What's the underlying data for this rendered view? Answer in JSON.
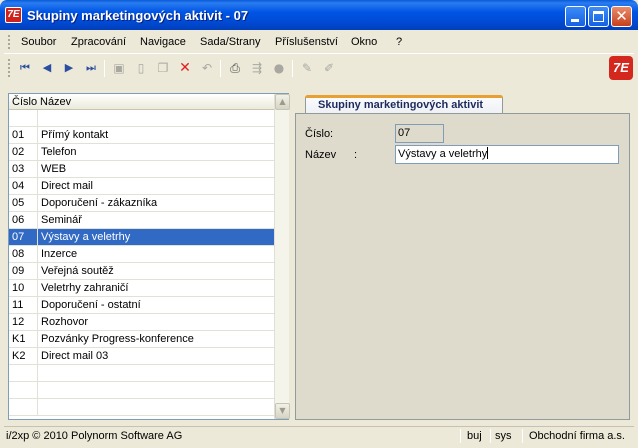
{
  "window": {
    "title": "Skupiny marketingových aktivit - 07",
    "icon_glyph": "7E",
    "controls": [
      "minimize-icon",
      "maximize-icon",
      "close-icon"
    ]
  },
  "menu": [
    "Soubor",
    "Zpracování",
    "Navigace",
    "Sada/Strany",
    "Příslušenství",
    "Okno",
    "?"
  ],
  "toolbar": {
    "icons": [
      "first-record-icon",
      "previous-record-icon",
      "next-record-icon",
      "last-record-icon",
      "save-icon",
      "new-icon",
      "copy-icon",
      "delete-icon",
      "undo-icon",
      "print-icon",
      "export-icon",
      "record-icon",
      "edit-pencil-icon",
      "edit-pencil-2-icon"
    ],
    "logo_text": "7E"
  },
  "grid": {
    "columns": [
      "Číslo",
      "Název"
    ],
    "rows": [
      {
        "cislo": "",
        "nazev": ""
      },
      {
        "cislo": "01",
        "nazev": "Přímý kontakt"
      },
      {
        "cislo": "02",
        "nazev": "Telefon"
      },
      {
        "cislo": "03",
        "nazev": "WEB"
      },
      {
        "cislo": "04",
        "nazev": "Direct mail"
      },
      {
        "cislo": "05",
        "nazev": "Doporučení - zákazníka"
      },
      {
        "cislo": "06",
        "nazev": "Seminář"
      },
      {
        "cislo": "07",
        "nazev": "Výstavy a veletrhy"
      },
      {
        "cislo": "08",
        "nazev": "Inzerce"
      },
      {
        "cislo": "09",
        "nazev": "Veřejná soutěž"
      },
      {
        "cislo": "10",
        "nazev": "Veletrhy zahraničí"
      },
      {
        "cislo": "11",
        "nazev": "Doporučení - ostatní"
      },
      {
        "cislo": "12",
        "nazev": "Rozhovor"
      },
      {
        "cislo": "K1",
        "nazev": "Pozvánky Progress-konference"
      },
      {
        "cislo": "K2",
        "nazev": "Direct mail 03"
      },
      {
        "cislo": "",
        "nazev": ""
      },
      {
        "cislo": "",
        "nazev": ""
      },
      {
        "cislo": "",
        "nazev": ""
      }
    ],
    "selected_index": 7
  },
  "detail": {
    "tab_label": "Skupiny marketingových aktivit",
    "cislo_label": "Číslo:",
    "cislo_value": "07",
    "nazev_label": "Název",
    "nazev_colon": ":",
    "nazev_value": "Výstavy a veletrhy"
  },
  "status": {
    "copyright": "i/2xp © 2010 Polynorm Software AG",
    "user": "buj",
    "db": "sys",
    "company": "Obchodní firma a.s."
  },
  "colors": {
    "title_bar": "#0055e5",
    "selection": "#316ac5",
    "accent": "#e8a030",
    "logo_red": "#d4281f"
  }
}
